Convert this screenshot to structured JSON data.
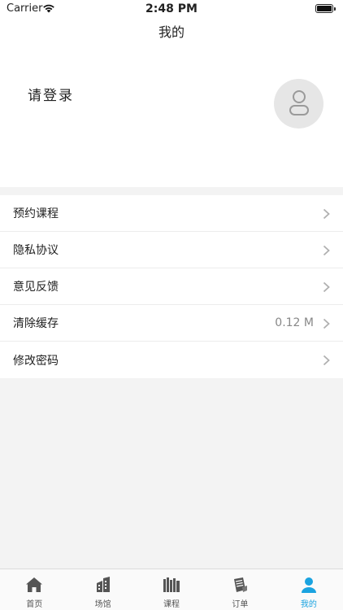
{
  "status_bar": {
    "carrier": "Carrier",
    "time": "2:48 PM"
  },
  "nav": {
    "title": "我的"
  },
  "profile": {
    "login_label": "请登录"
  },
  "menu": [
    {
      "label": "预约课程",
      "value": ""
    },
    {
      "label": "隐私协议",
      "value": ""
    },
    {
      "label": "意见反馈",
      "value": ""
    },
    {
      "label": "清除缓存",
      "value": "0.12 M"
    },
    {
      "label": "修改密码",
      "value": ""
    }
  ],
  "tabs": [
    {
      "label": "首页",
      "icon": "home-icon"
    },
    {
      "label": "场馆",
      "icon": "building-icon"
    },
    {
      "label": "课程",
      "icon": "books-icon"
    },
    {
      "label": "订单",
      "icon": "order-icon"
    },
    {
      "label": "我的",
      "icon": "profile-icon",
      "active": true
    }
  ],
  "colors": {
    "accent": "#1aa3e0",
    "inactive_icon": "#555555",
    "background": "#f3f3f3"
  }
}
